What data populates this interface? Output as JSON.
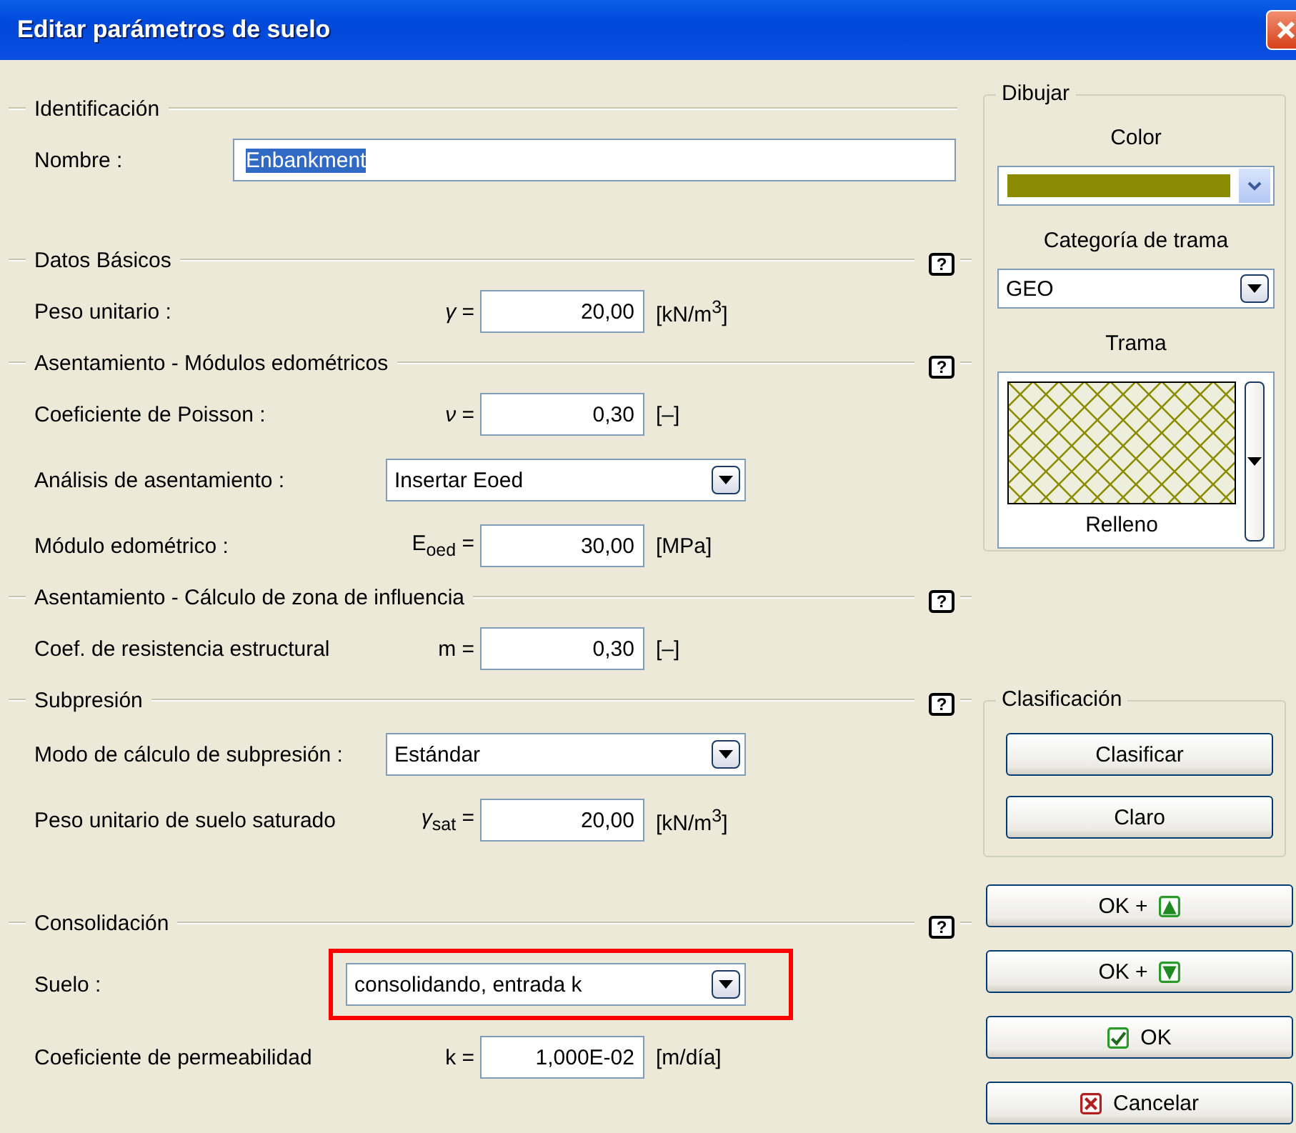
{
  "window": {
    "title": "Editar parámetros de suelo"
  },
  "sections": [
    {
      "title": "Identificación",
      "rows": [
        {
          "kind": "text",
          "label": "Nombre :",
          "value": "Enbankment",
          "selected": true
        }
      ]
    },
    {
      "title": "Datos Básicos",
      "help": "?",
      "rows": [
        {
          "kind": "number",
          "label": "Peso unitario :",
          "symbol": "*γ* =",
          "value": "20,00",
          "unit": "[kN/m$^{3}$]"
        }
      ]
    },
    {
      "title": "Asentamiento - Módulos edométricos",
      "help": "?",
      "rows": [
        {
          "kind": "number",
          "label": "Coeficiente de Poisson :",
          "symbol": "*ν* =",
          "value": "0,30",
          "unit": "[–]"
        },
        {
          "kind": "select",
          "label": "Análisis de asentamiento :",
          "value": "Insertar Eoed",
          "highlighted": false
        },
        {
          "kind": "number",
          "label": "Módulo edométrico :",
          "symbol": "E$_{oed}$ =",
          "value": "30,00",
          "unit": "[MPa]"
        }
      ]
    },
    {
      "title": "Asentamiento - Cálculo de zona de influencia",
      "help": "?",
      "rows": [
        {
          "kind": "number",
          "label": "Coef. de resistencia estructural",
          "symbol": "m =",
          "value": "0,30",
          "unit": "[–]"
        }
      ]
    },
    {
      "title": "Subpresión",
      "help": "?",
      "rows": [
        {
          "kind": "select",
          "label": "Modo de cálculo de subpresión :",
          "value": "Estándar",
          "highlighted": false
        },
        {
          "kind": "number",
          "label": "Peso unitario de suelo saturado",
          "symbol": "*γ*$_{sat}$ =",
          "value": "20,00",
          "unit": "[kN/m$^{3}$]"
        }
      ]
    },
    {
      "title": "Consolidación",
      "help": "?",
      "rows": [
        {
          "kind": "select",
          "label": "Suelo :",
          "value": "consolidando, entrada k",
          "highlighted": true
        },
        {
          "kind": "number",
          "label": "Coeficiente de permeabilidad",
          "symbol": "k =",
          "value": "1,000E-02",
          "unit": "[m/día]"
        }
      ]
    }
  ],
  "draw": {
    "title": "Dibujar",
    "color_label": "Color",
    "color": "#8b8b00",
    "category_label": "Categoría de trama",
    "category": "GEO",
    "pattern_label": "Trama",
    "pattern_name": "Relleno"
  },
  "classification": {
    "title": "Clasificación",
    "buttons": [
      "Clasificar",
      "Claro"
    ]
  },
  "actions": [
    {
      "kind": "ok_up",
      "label": "OK +"
    },
    {
      "kind": "ok_down",
      "label": "OK +"
    },
    {
      "kind": "ok",
      "label": "OK"
    },
    {
      "kind": "cancel",
      "label": "Cancelar"
    }
  ]
}
